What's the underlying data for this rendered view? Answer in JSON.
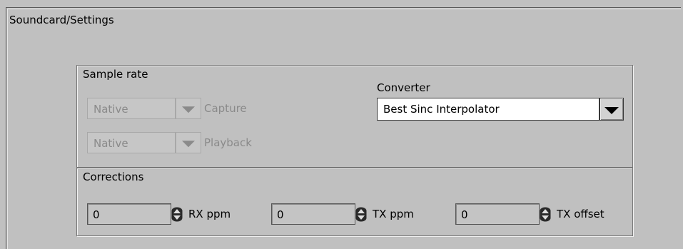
{
  "panel": {
    "title": "Soundcard/Settings"
  },
  "sample_rate": {
    "title": "Sample rate",
    "capture": {
      "value": "Native",
      "label": "Capture"
    },
    "playback": {
      "value": "Native",
      "label": "Playback"
    }
  },
  "converter": {
    "title": "Converter",
    "value": "Best Sinc Interpolator"
  },
  "corrections": {
    "title": "Corrections",
    "rx_ppm": {
      "value": "0",
      "label": "RX ppm"
    },
    "tx_ppm": {
      "value": "0",
      "label": "TX ppm"
    },
    "tx_offset": {
      "value": "0",
      "label": "TX offset"
    }
  },
  "icons": {
    "dropdown": "triangle-down-icon",
    "spinner": "up-down-stepper-icon"
  }
}
